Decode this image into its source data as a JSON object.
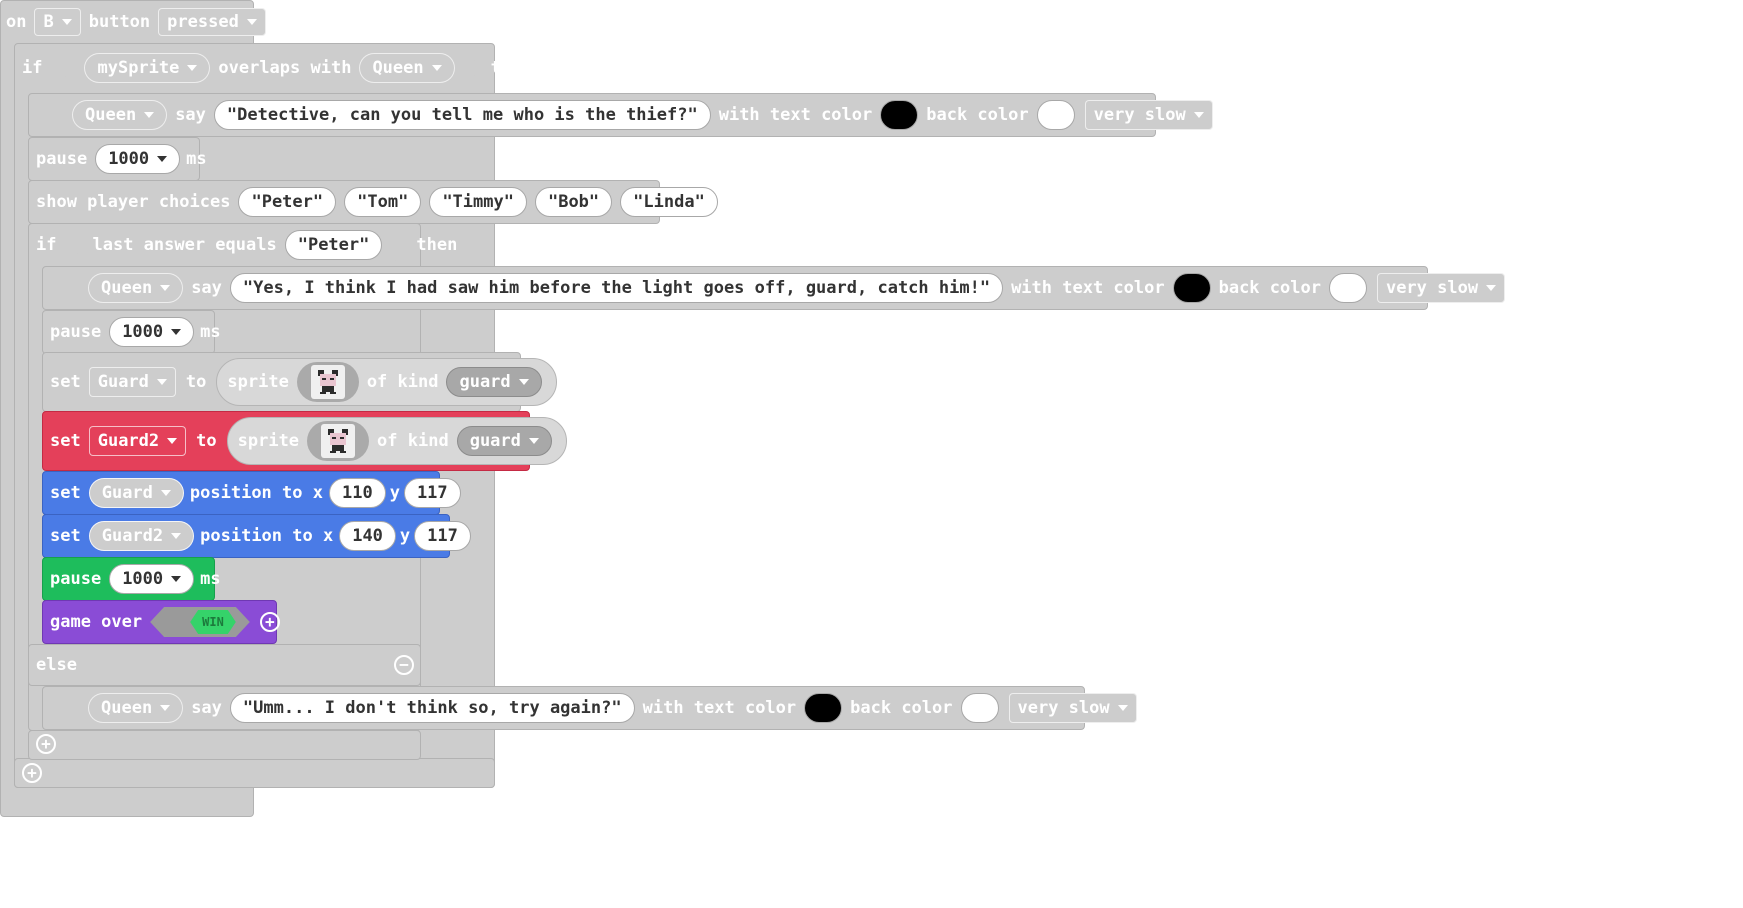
{
  "event": {
    "on": "on",
    "button_key": "B",
    "button": "button",
    "action": "pressed"
  },
  "if1": {
    "if": "if",
    "sprite": "mySprite",
    "overlaps": "overlaps with",
    "kind": "Queen",
    "then": "then"
  },
  "say1": {
    "sprite": "Queen",
    "say": "say",
    "text": "\"Detective, can you tell me who is the thief?\"",
    "with_text_color": "with text color",
    "back_color": "back color",
    "speed": "very slow"
  },
  "pause1": {
    "pause": "pause",
    "value": "1000",
    "unit": "ms"
  },
  "choices": {
    "label": "show player choices",
    "items": [
      "\"Peter\"",
      "\"Tom\"",
      "\"Timmy\"",
      "\"Bob\"",
      "\"Linda\""
    ]
  },
  "if2": {
    "if": "if",
    "cond": "last answer equals",
    "value": "\"Peter\"",
    "then": "then"
  },
  "say2": {
    "sprite": "Queen",
    "say": "say",
    "text": "\"Yes, I think I had saw him before the light goes off, guard, catch him!\"",
    "with_text_color": "with text color",
    "back_color": "back color",
    "speed": "very slow"
  },
  "pause2": {
    "pause": "pause",
    "value": "1000",
    "unit": "ms"
  },
  "set1": {
    "set": "set",
    "var": "Guard",
    "to": "to",
    "sprite": "sprite",
    "of_kind": "of kind",
    "kind": "guard"
  },
  "set2": {
    "set": "set",
    "var": "Guard2",
    "to": "to",
    "sprite": "sprite",
    "of_kind": "of kind",
    "kind": "guard"
  },
  "pos1": {
    "set": "set",
    "var": "Guard",
    "position": "position to x",
    "x": "110",
    "y_label": "y",
    "y": "117"
  },
  "pos2": {
    "set": "set",
    "var": "Guard2",
    "position": "position to x",
    "x": "140",
    "y_label": "y",
    "y": "117"
  },
  "pause3": {
    "pause": "pause",
    "value": "1000",
    "unit": "ms"
  },
  "gameover": {
    "label": "game over",
    "result": "WIN"
  },
  "else": {
    "label": "else"
  },
  "say3": {
    "sprite": "Queen",
    "say": "say",
    "text": "\"Umm... I don't think so, try again?\"",
    "with_text_color": "with text color",
    "back_color": "back color",
    "speed": "very slow"
  },
  "colors": {
    "grey": "#cdcdcd",
    "red": "#e4405a",
    "blue": "#4a7be6",
    "green": "#1ebd5c",
    "purple": "#8a4cd6",
    "win": "#35d36a"
  },
  "icons": {
    "plus": "plus-circle-icon",
    "minus": "minus-circle-icon",
    "sprite": "guard-sprite-image"
  }
}
